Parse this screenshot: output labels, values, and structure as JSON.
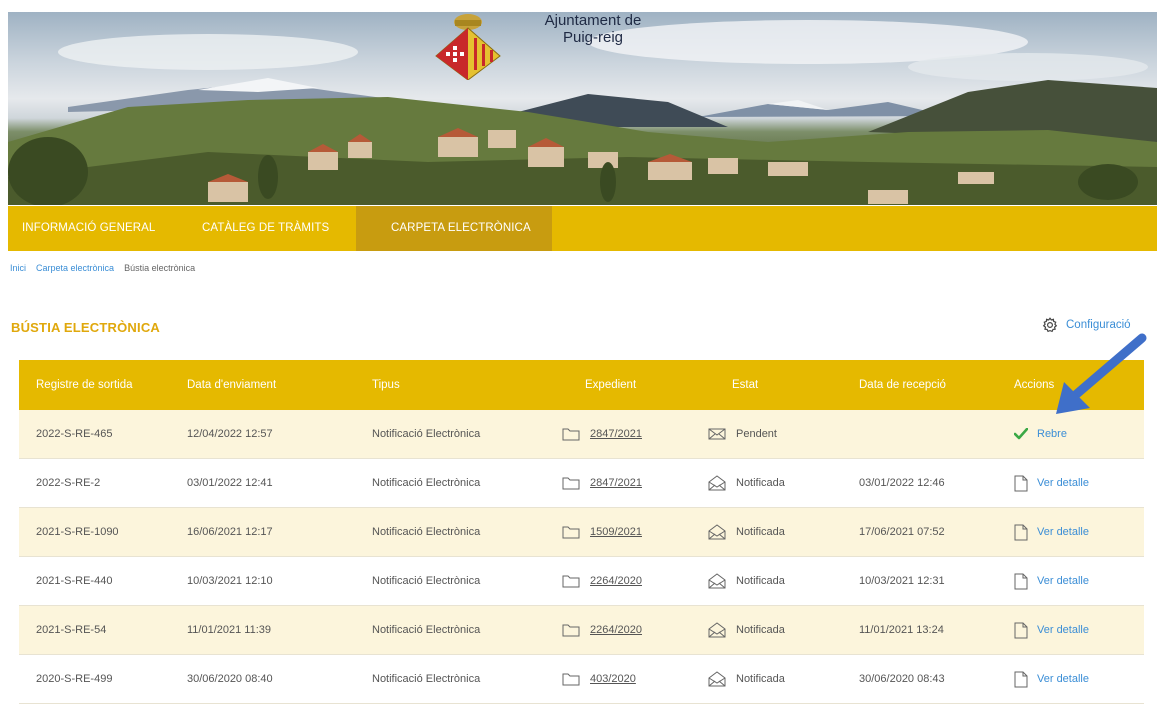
{
  "header": {
    "town_line1": "Ajuntament de",
    "town_line2": "Puig-reig"
  },
  "nav": {
    "items": [
      {
        "label": "INFORMACIÓ GENERAL"
      },
      {
        "label": "CATÀLEG DE TRÀMITS"
      },
      {
        "label": "CARPETA ELECTRÒNICA",
        "active": true
      }
    ]
  },
  "breadcrumb": {
    "items": [
      "Inici",
      "Carpeta electrònica",
      "Bústia electrònica"
    ]
  },
  "section": {
    "title": "BÚSTIA ELECTRÒNICA",
    "config_label": "Configuració"
  },
  "table": {
    "headers": [
      "Registre de sortida",
      "Data d'enviament",
      "Tipus",
      "Expedient",
      "Estat",
      "Data de recepció",
      "Accions"
    ],
    "rows": [
      {
        "registre": "2022-S-RE-465",
        "data_enviament": "12/04/2022 12:57",
        "tipus": "Notificació Electrònica",
        "expedient": "2847/2021",
        "estat": "Pendent",
        "data_recepcio": "",
        "accio": "Rebre"
      },
      {
        "registre": "2022-S-RE-2",
        "data_enviament": "03/01/2022 12:41",
        "tipus": "Notificació Electrònica",
        "expedient": "2847/2021",
        "estat": "Notificada",
        "data_recepcio": "03/01/2022 12:46",
        "accio": "Ver detalle"
      },
      {
        "registre": "2021-S-RE-1090",
        "data_enviament": "16/06/2021 12:17",
        "tipus": "Notificació Electrònica",
        "expedient": "1509/2021",
        "estat": "Notificada",
        "data_recepcio": "17/06/2021 07:52",
        "accio": "Ver detalle"
      },
      {
        "registre": "2021-S-RE-440",
        "data_enviament": "10/03/2021 12:10",
        "tipus": "Notificació Electrònica",
        "expedient": "2264/2020",
        "estat": "Notificada",
        "data_recepcio": "10/03/2021 12:31",
        "accio": "Ver detalle"
      },
      {
        "registre": "2021-S-RE-54",
        "data_enviament": "11/01/2021 11:39",
        "tipus": "Notificació Electrònica",
        "expedient": "2264/2020",
        "estat": "Notificada",
        "data_recepcio": "11/01/2021 13:24",
        "accio": "Ver detalle"
      },
      {
        "registre": "2020-S-RE-499",
        "data_enviament": "30/06/2020 08:40",
        "tipus": "Notificació Electrònica",
        "expedient": "403/2020",
        "estat": "Notificada",
        "data_recepcio": "30/06/2020 08:43",
        "accio": "Ver detalle"
      }
    ]
  },
  "icons": {
    "folder": "folder-icon",
    "envelope_closed": "envelope-icon",
    "envelope_open": "envelope-open-icon",
    "check": "check-icon",
    "document": "document-icon",
    "gear": "gear-icon",
    "arrow": "arrow-icon"
  },
  "colors": {
    "nav_bg": "#e5b900",
    "nav_active": "#c89c10",
    "title": "#e0a80c",
    "link": "#3b8ed6",
    "row_alt": "#fcf5dc",
    "check": "#3aa845",
    "arrow": "#3f6fc9"
  }
}
